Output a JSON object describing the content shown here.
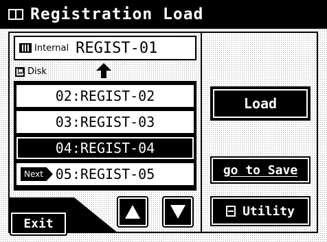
{
  "header": {
    "title": "Registration Load",
    "icon": "book-icon"
  },
  "internal": {
    "label": "Internal",
    "value": "REGIST-01",
    "icon": "keyboard-icon"
  },
  "disk": {
    "label": "Disk",
    "icon": "floppy-disk-icon"
  },
  "list": {
    "items": [
      {
        "text": "02:REGIST-02",
        "selected": false
      },
      {
        "text": "03:REGIST-03",
        "selected": false
      },
      {
        "text": "04:REGIST-04",
        "selected": true
      },
      {
        "text": "05:REGIST-05",
        "selected": false
      }
    ],
    "next_label": "Next"
  },
  "buttons": {
    "load": "Load",
    "save": "go to Save",
    "utility": "Utility",
    "exit": "Exit"
  },
  "colors": {
    "foreground": "#000000",
    "background": "#ffffff"
  }
}
